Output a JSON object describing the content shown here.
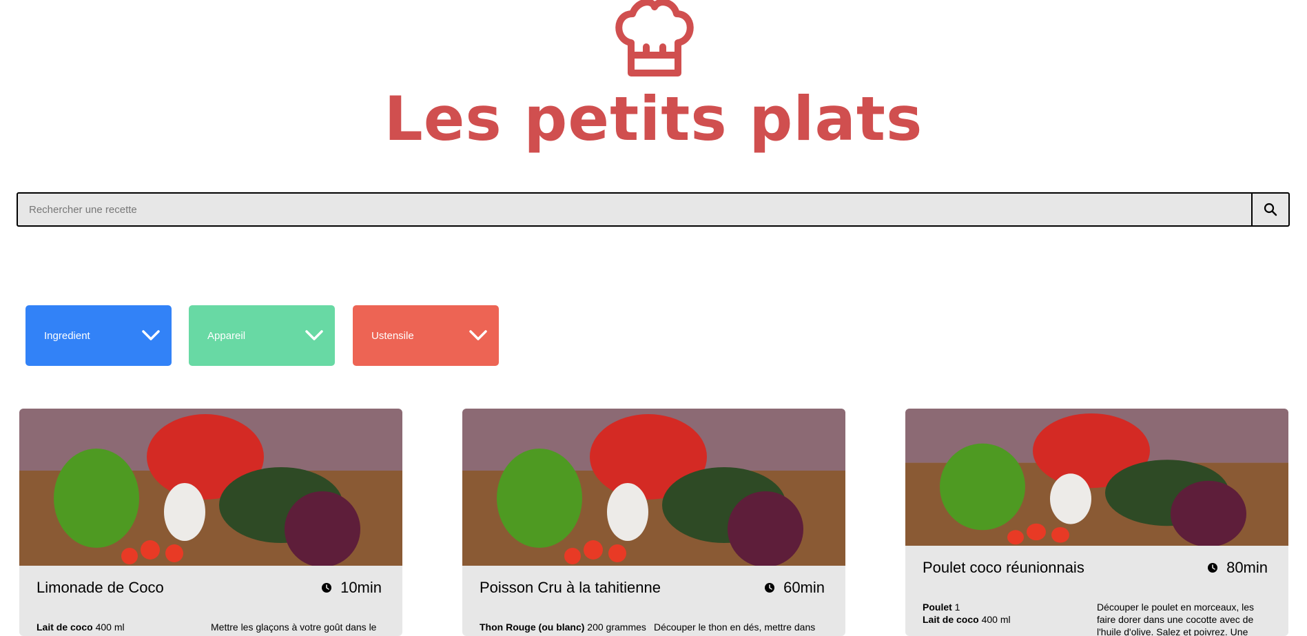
{
  "header": {
    "logo_text": "Les petits plats"
  },
  "search": {
    "placeholder": "Rechercher une recette",
    "value": ""
  },
  "filters": [
    {
      "label": "Ingredient",
      "color": "#3282F7"
    },
    {
      "label": "Appareil",
      "color": "#68D9A4"
    },
    {
      "label": "Ustensile",
      "color": "#ED6454"
    }
  ],
  "recipes": [
    {
      "title": "Limonade de Coco",
      "time": "10min",
      "ingredients": [
        {
          "name": "Lait de coco",
          "qty": " 400 ml"
        }
      ],
      "description": "Mettre les glaçons à votre goût dans le"
    },
    {
      "title": "Poisson Cru à la tahitienne",
      "time": "60min",
      "ingredients": [
        {
          "name": "Thon Rouge (ou blanc)",
          "qty": " 200 grammes"
        }
      ],
      "description": "Découper le thon en dés, mettre dans"
    },
    {
      "title": "Poulet coco réunionnais",
      "time": "80min",
      "ingredients": [
        {
          "name": "Poulet",
          "qty": " 1"
        },
        {
          "name": "Lait de coco",
          "qty": " 400 ml"
        }
      ],
      "description": "Découper le poulet en morceaux, les faire dorer dans une cocotte avec de l'huile d'olive. Salez et poivrez. Une"
    }
  ],
  "colors": {
    "brand": "#D04F4F",
    "card_bg": "#E7E7E7",
    "search_bg": "#E7E7E7"
  }
}
